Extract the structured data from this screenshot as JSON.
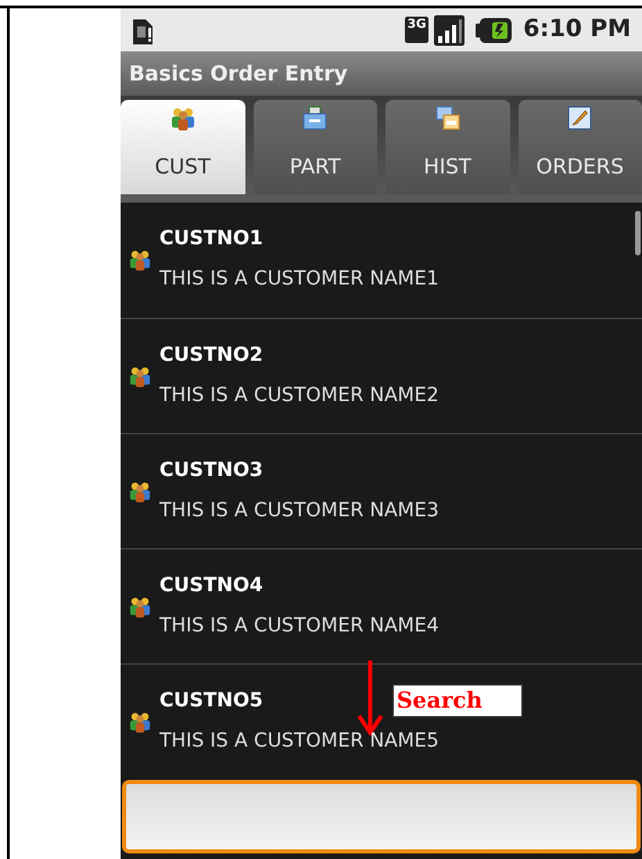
{
  "status_bar": {
    "network": "3G",
    "time": "6:10 PM"
  },
  "title": "Basics Order Entry",
  "tabs": [
    {
      "label": "CUST",
      "selected": true,
      "kind": "people"
    },
    {
      "label": "PART",
      "selected": false,
      "kind": "drawer"
    },
    {
      "label": "HIST",
      "selected": false,
      "kind": "windows"
    },
    {
      "label": "ORDERS",
      "selected": false,
      "kind": "edit"
    }
  ],
  "customers": [
    {
      "code": "CUSTNO1",
      "name": "THIS IS A CUSTOMER NAME1"
    },
    {
      "code": "CUSTNO2",
      "name": "THIS IS A CUSTOMER NAME2"
    },
    {
      "code": "CUSTNO3",
      "name": "THIS IS A CUSTOMER NAME3"
    },
    {
      "code": "CUSTNO4",
      "name": "THIS IS A CUSTOMER NAME4"
    },
    {
      "code": "CUSTNO5",
      "name": "THIS IS A CUSTOMER NAME5"
    }
  ],
  "annotation": {
    "label": "Search"
  }
}
